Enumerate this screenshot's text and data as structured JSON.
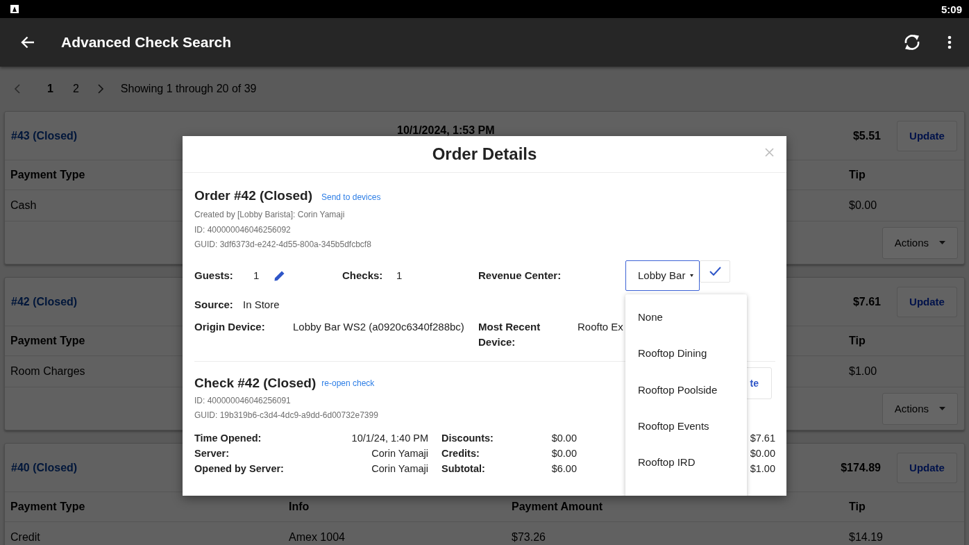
{
  "status_bar": {
    "time": "5:09"
  },
  "app_bar": {
    "title": "Advanced Check Search"
  },
  "pagination": {
    "prev": {
      "disabled": true
    },
    "pages": [
      {
        "label": "1",
        "selected": true
      },
      {
        "label": "2",
        "selected": false
      }
    ],
    "next": {
      "disabled": false
    },
    "summary": "Showing 1 through 20 of 39"
  },
  "checks": [
    {
      "title": "#43 (Closed)",
      "date": "10/1/2024, 1:53 PM",
      "total": "$5.51",
      "update_button": "Update",
      "columns": [
        "Payment Type",
        null,
        null,
        "Tip"
      ],
      "rows": [
        [
          "Cash",
          null,
          null,
          "$0.00"
        ]
      ],
      "actions_button": "Actions"
    },
    {
      "title": "#42 (Closed)",
      "total": "$7.61",
      "update_button": "Update",
      "columns": [
        "Payment Type",
        null,
        null,
        "Tip"
      ],
      "rows": [
        [
          "Room Charges",
          null,
          null,
          "$1.00"
        ]
      ],
      "actions_button": "Actions"
    },
    {
      "title": "#40 (Closed)",
      "total": "$174.89",
      "update_button": "Update",
      "columns": [
        "Payment Type",
        "Info",
        "Payment Amount",
        "Tip"
      ],
      "rows": [
        [
          "Credit",
          "Amex 1004",
          "$73.26",
          "$14.19"
        ]
      ]
    }
  ],
  "order_details": {
    "title": "Order Details",
    "order": {
      "title": "Order #42 (Closed)",
      "link": "Send to devices",
      "meta": [
        "Created by [Lobby Barista]: Corin Yamaji",
        "ID: 400000046046256092",
        "GUID: 3df6373d-e242-4d55-800a-345b5dfcbcf8"
      ]
    },
    "fields": {
      "guests_label": "Guests:",
      "guests": "1",
      "checks_label": "Checks:",
      "checks": "1",
      "revenue_center_label": "Revenue Center:",
      "revenue_center": "Lobby Bar",
      "source_label": "Source:",
      "source": "In Store",
      "origin_device_label": "Origin Device:",
      "origin_device": "Lobby Bar WS2 (a0920c6340f288bc)",
      "most_recent_device_label": "Most Recent Device:",
      "most_recent_device": "Roofto Ex"
    },
    "check": {
      "title": "Check #42 (Closed)",
      "link": "re-open check",
      "meta": [
        "ID: 400000046046256091",
        "GUID: 19b319b6-c3d4-4dc9-a9dd-6d00732e7399"
      ],
      "button": "te",
      "summary": [
        [
          {
            "label": "Time Opened:",
            "value": "10/1/24, 1:40 PM"
          },
          {
            "label": "Discounts:",
            "value": "$0.00"
          },
          {
            "value": "$7.61"
          }
        ],
        [
          {
            "label": "Server:",
            "value": "Corin Yamaji"
          },
          {
            "label": "Credits:",
            "value": "$0.00"
          },
          {
            "value": "$0.00"
          }
        ],
        [
          {
            "label": "Opened by Server:",
            "value": "Corin Yamaji"
          },
          {
            "label": "Subtotal:",
            "value": "$6.00"
          },
          {
            "value": "$1.00"
          }
        ]
      ]
    },
    "revenue_center_options": [
      {
        "label": "None",
        "selected": false
      },
      {
        "label": "Rooftop Dining",
        "selected": false
      },
      {
        "label": "Rooftop Poolside",
        "selected": false
      },
      {
        "label": "Rooftop Events",
        "selected": false
      },
      {
        "label": "Rooftop IRD",
        "selected": false
      }
    ]
  }
}
